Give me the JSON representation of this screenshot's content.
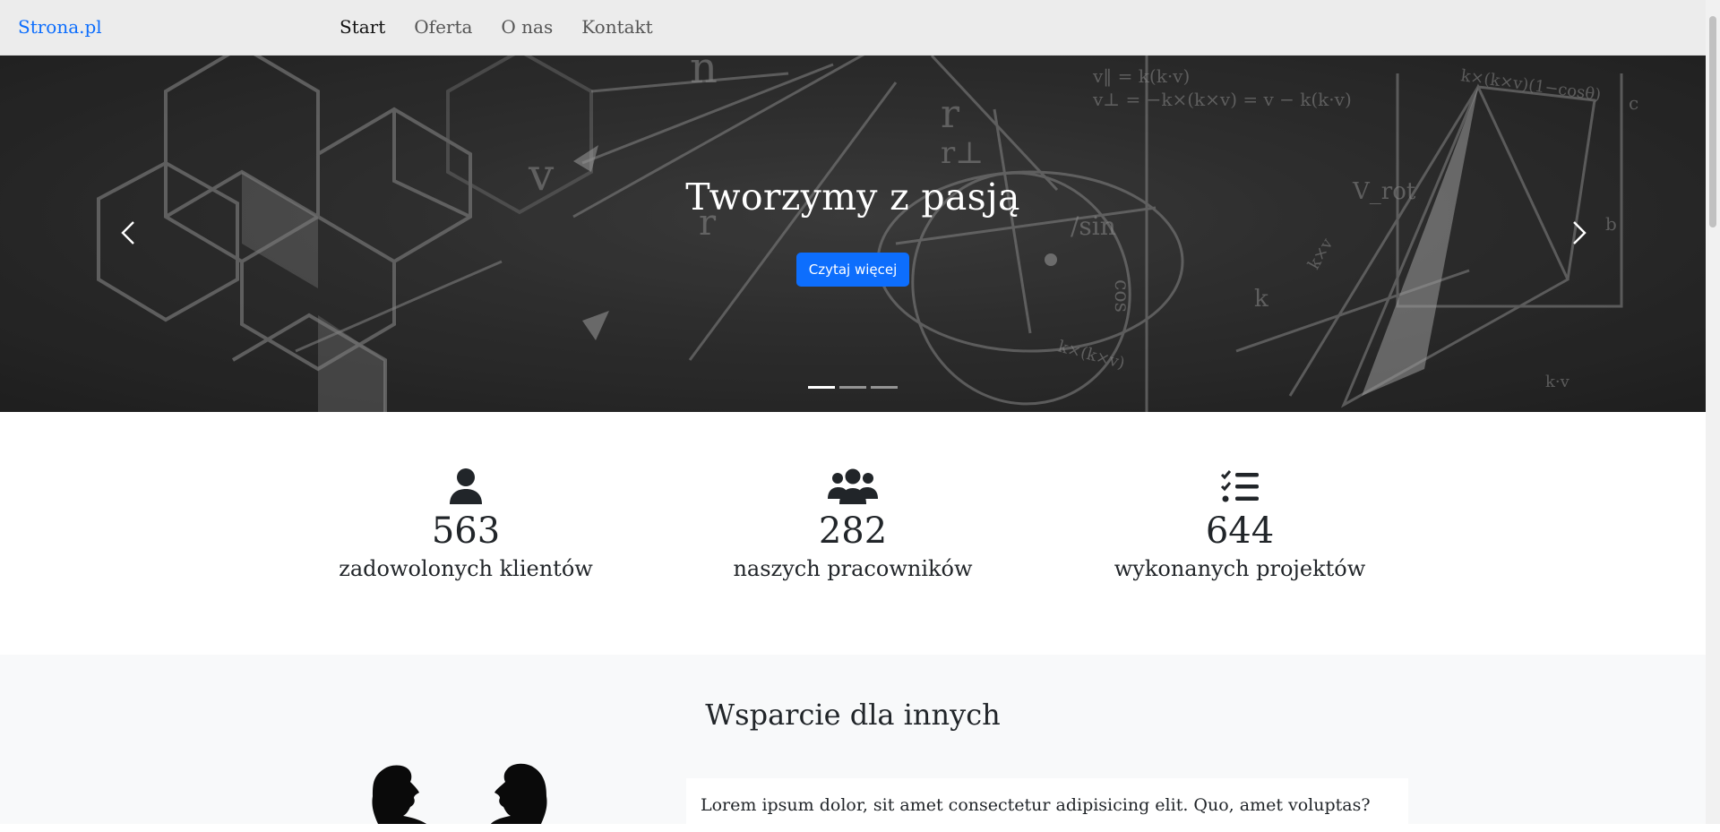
{
  "navbar": {
    "brand": "Strona.pl",
    "links": [
      {
        "label": "Start",
        "active": true
      },
      {
        "label": "Oferta",
        "active": false
      },
      {
        "label": "O nas",
        "active": false
      },
      {
        "label": "Kontakt",
        "active": false
      }
    ]
  },
  "hero": {
    "title": "Tworzymy z pasją",
    "button_label": "Czytaj więcej",
    "slide_count": 3,
    "active_slide": 1,
    "prev_icon": "chevron-left-icon",
    "next_icon": "chevron-right-icon",
    "background_texts": [
      "n",
      "v",
      "r",
      "r",
      "/sin",
      "cos",
      "k",
      "k×(k×v)",
      "V_rot",
      "b",
      "c",
      "r⊥",
      "v‖ = k(k·v)",
      "v⊥ = −k×(k×v) = v − k(k·v)",
      "k×(k×v)(1−cosθ)",
      "k×v",
      "k·v"
    ]
  },
  "stats": [
    {
      "icon": "user-icon",
      "number": "563",
      "label": "zadowolonych klientów"
    },
    {
      "icon": "users-icon",
      "number": "282",
      "label": "naszych pracowników"
    },
    {
      "icon": "list-check-icon",
      "number": "644",
      "label": "wykonanych projektów"
    }
  ],
  "support": {
    "title": "Wsparcie dla innych",
    "illustration_icon": "two-people-silhouette-icon",
    "text": "Lorem ipsum dolor, sit amet consectetur adipisicing elit. Quo, amet voluptas?"
  },
  "colors": {
    "brand": "#0d6efd",
    "navbar_bg": "#ececec",
    "hero_bg": "#363636",
    "section_bg": "#f8f9fa",
    "text": "#212529"
  }
}
